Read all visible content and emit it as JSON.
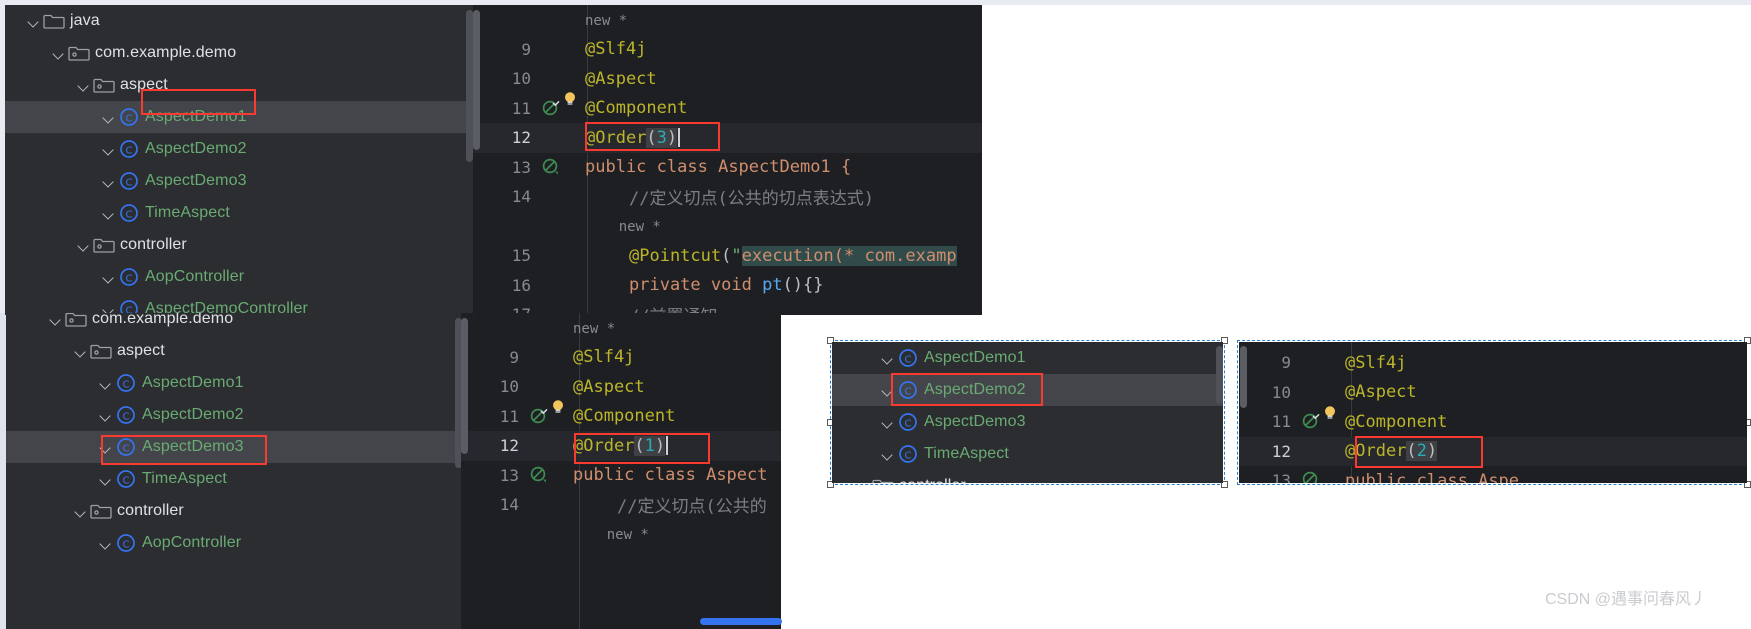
{
  "app": {
    "accent_red": "#f93a31",
    "accent_blue": "#2f7fd1",
    "tree_bg": "#2b2d30",
    "editor_bg": "#1e1f22",
    "class_color": "#6aab73",
    "annotation_color": "#bbb529"
  },
  "top_tree": {
    "name": "project-tree-top",
    "rows": [
      {
        "label": "java",
        "kind": "folder",
        "indent": 0,
        "chevron": false,
        "selected": false,
        "clipped": true
      },
      {
        "label": "com.example.demo",
        "kind": "package",
        "indent": 1,
        "chevron": true,
        "selected": false
      },
      {
        "label": "aspect",
        "kind": "package",
        "indent": 2,
        "chevron": true,
        "selected": false
      },
      {
        "label": "AspectDemo1",
        "kind": "class",
        "indent": 3,
        "chevron": false,
        "selected": true
      },
      {
        "label": "AspectDemo2",
        "kind": "class",
        "indent": 3,
        "chevron": false,
        "selected": false
      },
      {
        "label": "AspectDemo3",
        "kind": "class",
        "indent": 3,
        "chevron": false,
        "selected": false
      },
      {
        "label": "TimeAspect",
        "kind": "class",
        "indent": 3,
        "chevron": false,
        "selected": false
      },
      {
        "label": "controller",
        "kind": "package",
        "indent": 2,
        "chevron": true,
        "selected": false
      },
      {
        "label": "AopController",
        "kind": "class",
        "indent": 3,
        "chevron": false,
        "selected": false
      },
      {
        "label": "AspectDemoController",
        "kind": "class",
        "indent": 3,
        "chevron": false,
        "selected": false
      }
    ]
  },
  "top_editor": {
    "name": "code-editor-top",
    "fold_hint": "new *",
    "lines": [
      {
        "no": "",
        "marker": "",
        "bulb": false,
        "current": false,
        "kind": "fold",
        "text": "new *"
      },
      {
        "no": "9",
        "marker": "",
        "bulb": false,
        "current": false,
        "kind": "ann",
        "text": "@Slf4j"
      },
      {
        "no": "10",
        "marker": "",
        "bulb": false,
        "current": false,
        "kind": "ann",
        "text": "@Aspect"
      },
      {
        "no": "11",
        "marker": "run-ok",
        "bulb": true,
        "current": false,
        "kind": "ann",
        "text": "@Component"
      },
      {
        "no": "12",
        "marker": "",
        "bulb": false,
        "current": true,
        "kind": "order",
        "text": "@Order",
        "arg": "3",
        "boxed": true,
        "caret": true
      },
      {
        "no": "13",
        "marker": "run",
        "bulb": false,
        "current": false,
        "kind": "class",
        "text": "public class AspectDemo1 {"
      },
      {
        "no": "14",
        "marker": "",
        "bulb": false,
        "current": false,
        "kind": "comment",
        "text": "//定义切点(公共的切点表达式)"
      },
      {
        "no": "",
        "marker": "",
        "bulb": false,
        "current": false,
        "kind": "fold2",
        "text": "new *"
      },
      {
        "no": "15",
        "marker": "",
        "bulb": false,
        "current": false,
        "kind": "pointcut",
        "text": "@Pointcut(\"",
        "exec": "execution(* com.examp"
      },
      {
        "no": "16",
        "marker": "",
        "bulb": false,
        "current": false,
        "kind": "method",
        "text": "private void pt(){}"
      },
      {
        "no": "17",
        "marker": "",
        "bulb": false,
        "current": false,
        "kind": "comment2",
        "text": "//前置通知"
      }
    ]
  },
  "bottom_tree": {
    "name": "project-tree-bottom",
    "rows": [
      {
        "label": "com.example.demo",
        "kind": "package",
        "indent": 1,
        "chevron": true,
        "selected": false,
        "clipped": true
      },
      {
        "label": "aspect",
        "kind": "package",
        "indent": 2,
        "chevron": true,
        "selected": false
      },
      {
        "label": "AspectDemo1",
        "kind": "class",
        "indent": 3,
        "chevron": false,
        "selected": false
      },
      {
        "label": "AspectDemo2",
        "kind": "class",
        "indent": 3,
        "chevron": false,
        "selected": false
      },
      {
        "label": "AspectDemo3",
        "kind": "class",
        "indent": 3,
        "chevron": false,
        "selected": true
      },
      {
        "label": "TimeAspect",
        "kind": "class",
        "indent": 3,
        "chevron": false,
        "selected": false
      },
      {
        "label": "controller",
        "kind": "package",
        "indent": 2,
        "chevron": true,
        "selected": false
      },
      {
        "label": "AopController",
        "kind": "class",
        "indent": 3,
        "chevron": false,
        "selected": false
      }
    ]
  },
  "bottom_editor": {
    "name": "code-editor-bottom",
    "lines": [
      {
        "no": "",
        "marker": "",
        "bulb": false,
        "current": false,
        "kind": "fold",
        "text": "new *"
      },
      {
        "no": "9",
        "marker": "",
        "bulb": false,
        "current": false,
        "kind": "ann",
        "text": "@Slf4j"
      },
      {
        "no": "10",
        "marker": "",
        "bulb": false,
        "current": false,
        "kind": "ann",
        "text": "@Aspect"
      },
      {
        "no": "11",
        "marker": "run-ok",
        "bulb": true,
        "current": false,
        "kind": "ann",
        "text": "@Component"
      },
      {
        "no": "12",
        "marker": "",
        "bulb": false,
        "current": true,
        "kind": "order",
        "text": "@Order",
        "arg": "1",
        "boxed": true,
        "caret": true
      },
      {
        "no": "13",
        "marker": "run",
        "bulb": false,
        "current": false,
        "kind": "class",
        "text": "public class Aspect"
      },
      {
        "no": "14",
        "marker": "",
        "bulb": false,
        "current": false,
        "kind": "comment",
        "text": "//定义切点(公共的"
      },
      {
        "no": "",
        "marker": "",
        "bulb": false,
        "current": false,
        "kind": "fold2",
        "text": "new *"
      }
    ]
  },
  "right_tree": {
    "name": "project-tree-right",
    "rows": [
      {
        "label": "AspectDemo1",
        "kind": "class",
        "indent": 3,
        "chevron": false,
        "selected": false
      },
      {
        "label": "AspectDemo2",
        "kind": "class",
        "indent": 3,
        "chevron": false,
        "selected": true
      },
      {
        "label": "AspectDemo3",
        "kind": "class",
        "indent": 3,
        "chevron": false,
        "selected": false
      },
      {
        "label": "TimeAspect",
        "kind": "class",
        "indent": 3,
        "chevron": false,
        "selected": false
      },
      {
        "label": "controller",
        "kind": "package",
        "indent": 2,
        "chevron": false,
        "selected": false,
        "clipped": true
      }
    ]
  },
  "right_editor": {
    "name": "code-editor-right",
    "lines": [
      {
        "no": "9",
        "marker": "",
        "bulb": false,
        "current": false,
        "kind": "ann",
        "text": "@Slf4j"
      },
      {
        "no": "10",
        "marker": "",
        "bulb": false,
        "current": false,
        "kind": "ann",
        "text": "@Aspect"
      },
      {
        "no": "11",
        "marker": "run-ok",
        "bulb": true,
        "current": false,
        "kind": "ann",
        "text": "@Component"
      },
      {
        "no": "12",
        "marker": "",
        "bulb": false,
        "current": true,
        "kind": "order",
        "text": "@Order",
        "arg": "2",
        "boxed": true,
        "caret": false
      },
      {
        "no": "13",
        "marker": "run",
        "bulb": false,
        "current": false,
        "kind": "class",
        "text": "public class Aspe"
      }
    ]
  },
  "watermark": {
    "text": "CSDN @遇事问春风丿"
  }
}
